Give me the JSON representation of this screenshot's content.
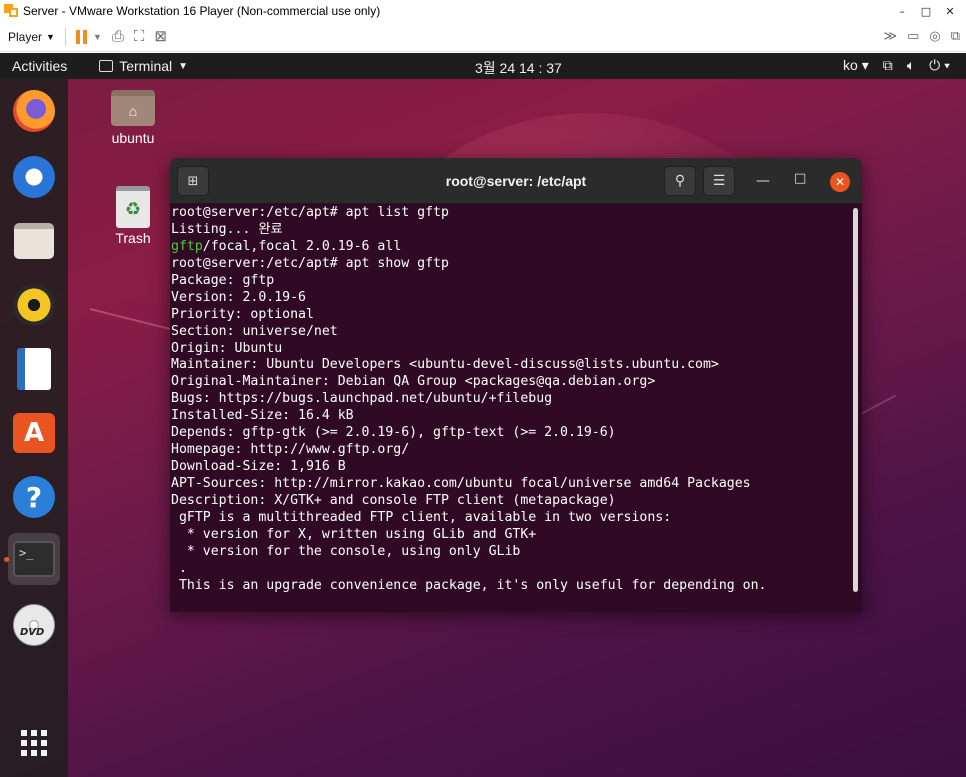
{
  "vmware": {
    "title": "Server - VMware Workstation 16 Player (Non-commercial use only)",
    "player_menu": "Player",
    "minimize": "–",
    "maximize": "□",
    "close": "✕"
  },
  "topbar": {
    "activities": "Activities",
    "app_menu": "Terminal",
    "clock": "3월 24  14 : 37",
    "input_method": "ko"
  },
  "desktop": {
    "icons": [
      {
        "label": "ubuntu"
      },
      {
        "label": "Trash"
      }
    ]
  },
  "dock": {
    "items": [
      "firefox-icon",
      "thunderbird-icon",
      "files-icon",
      "rhythmbox-icon",
      "libreoffice-writer-icon",
      "ubuntu-software-icon",
      "help-icon",
      "terminal-icon",
      "dvd-icon",
      "show-applications-icon"
    ]
  },
  "terminal": {
    "title": "root@server: /etc/apt",
    "lines": [
      {
        "pre": "root@server:/etc/apt# apt list gftp",
        "green": "",
        "post": ""
      },
      {
        "pre": "Listing... 완료",
        "green": "",
        "post": ""
      },
      {
        "pre": "",
        "green": "gftp",
        "post": "/focal,focal 2.0.19-6 all"
      },
      {
        "pre": "root@server:/etc/apt# apt show gftp",
        "green": "",
        "post": ""
      },
      {
        "pre": "Package: gftp",
        "green": "",
        "post": ""
      },
      {
        "pre": "Version: 2.0.19-6",
        "green": "",
        "post": ""
      },
      {
        "pre": "Priority: optional",
        "green": "",
        "post": ""
      },
      {
        "pre": "Section: universe/net",
        "green": "",
        "post": ""
      },
      {
        "pre": "Origin: Ubuntu",
        "green": "",
        "post": ""
      },
      {
        "pre": "Maintainer: Ubuntu Developers <ubuntu-devel-discuss@lists.ubuntu.com>",
        "green": "",
        "post": ""
      },
      {
        "pre": "Original-Maintainer: Debian QA Group <packages@qa.debian.org>",
        "green": "",
        "post": ""
      },
      {
        "pre": "Bugs: https://bugs.launchpad.net/ubuntu/+filebug",
        "green": "",
        "post": ""
      },
      {
        "pre": "Installed-Size: 16.4 kB",
        "green": "",
        "post": ""
      },
      {
        "pre": "Depends: gftp-gtk (>= 2.0.19-6), gftp-text (>= 2.0.19-6)",
        "green": "",
        "post": ""
      },
      {
        "pre": "Homepage: http://www.gftp.org/",
        "green": "",
        "post": ""
      },
      {
        "pre": "Download-Size: 1,916 B",
        "green": "",
        "post": ""
      },
      {
        "pre": "APT-Sources: http://mirror.kakao.com/ubuntu focal/universe amd64 Packages",
        "green": "",
        "post": ""
      },
      {
        "pre": "Description: X/GTK+ and console FTP client (metapackage)",
        "green": "",
        "post": ""
      },
      {
        "pre": " gFTP is a multithreaded FTP client, available in two versions:",
        "green": "",
        "post": ""
      },
      {
        "pre": "  * version for X, written using GLib and GTK+",
        "green": "",
        "post": ""
      },
      {
        "pre": "  * version for the console, using only GLib",
        "green": "",
        "post": ""
      },
      {
        "pre": " .",
        "green": "",
        "post": ""
      },
      {
        "pre": " This is an upgrade convenience package, it's only useful for depending on.",
        "green": "",
        "post": ""
      }
    ]
  },
  "colors": {
    "terminal_bg": "#300a24",
    "accent": "#e95420",
    "green_text": "#4ec93a"
  }
}
